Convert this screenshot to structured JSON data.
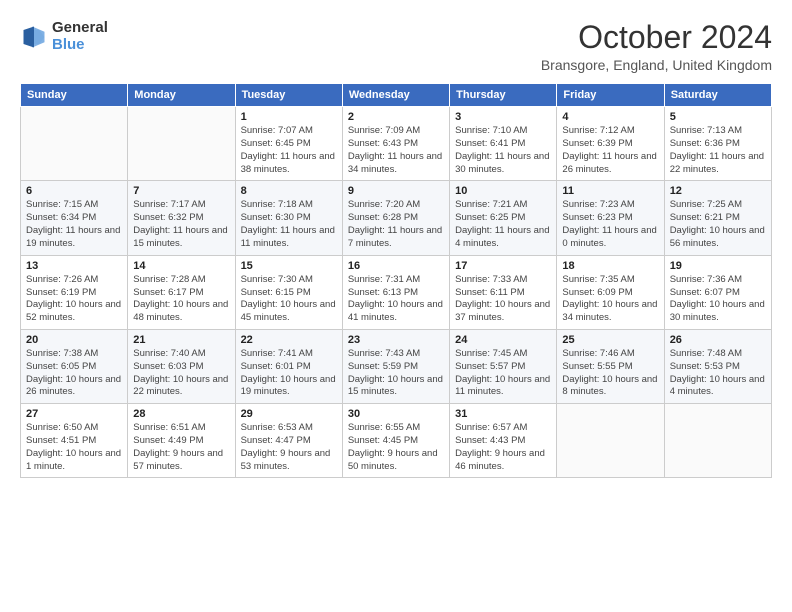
{
  "logo": {
    "line1": "General",
    "line2": "Blue",
    "icon_color": "#4a90d9"
  },
  "header": {
    "month_year": "October 2024",
    "location": "Bransgore, England, United Kingdom"
  },
  "days_of_week": [
    "Sunday",
    "Monday",
    "Tuesday",
    "Wednesday",
    "Thursday",
    "Friday",
    "Saturday"
  ],
  "weeks": [
    [
      {
        "day": "",
        "sunrise": "",
        "sunset": "",
        "daylight": "",
        "empty": true
      },
      {
        "day": "",
        "sunrise": "",
        "sunset": "",
        "daylight": "",
        "empty": true
      },
      {
        "day": "1",
        "sunrise": "Sunrise: 7:07 AM",
        "sunset": "Sunset: 6:45 PM",
        "daylight": "Daylight: 11 hours and 38 minutes.",
        "empty": false
      },
      {
        "day": "2",
        "sunrise": "Sunrise: 7:09 AM",
        "sunset": "Sunset: 6:43 PM",
        "daylight": "Daylight: 11 hours and 34 minutes.",
        "empty": false
      },
      {
        "day": "3",
        "sunrise": "Sunrise: 7:10 AM",
        "sunset": "Sunset: 6:41 PM",
        "daylight": "Daylight: 11 hours and 30 minutes.",
        "empty": false
      },
      {
        "day": "4",
        "sunrise": "Sunrise: 7:12 AM",
        "sunset": "Sunset: 6:39 PM",
        "daylight": "Daylight: 11 hours and 26 minutes.",
        "empty": false
      },
      {
        "day": "5",
        "sunrise": "Sunrise: 7:13 AM",
        "sunset": "Sunset: 6:36 PM",
        "daylight": "Daylight: 11 hours and 22 minutes.",
        "empty": false
      }
    ],
    [
      {
        "day": "6",
        "sunrise": "Sunrise: 7:15 AM",
        "sunset": "Sunset: 6:34 PM",
        "daylight": "Daylight: 11 hours and 19 minutes.",
        "empty": false
      },
      {
        "day": "7",
        "sunrise": "Sunrise: 7:17 AM",
        "sunset": "Sunset: 6:32 PM",
        "daylight": "Daylight: 11 hours and 15 minutes.",
        "empty": false
      },
      {
        "day": "8",
        "sunrise": "Sunrise: 7:18 AM",
        "sunset": "Sunset: 6:30 PM",
        "daylight": "Daylight: 11 hours and 11 minutes.",
        "empty": false
      },
      {
        "day": "9",
        "sunrise": "Sunrise: 7:20 AM",
        "sunset": "Sunset: 6:28 PM",
        "daylight": "Daylight: 11 hours and 7 minutes.",
        "empty": false
      },
      {
        "day": "10",
        "sunrise": "Sunrise: 7:21 AM",
        "sunset": "Sunset: 6:25 PM",
        "daylight": "Daylight: 11 hours and 4 minutes.",
        "empty": false
      },
      {
        "day": "11",
        "sunrise": "Sunrise: 7:23 AM",
        "sunset": "Sunset: 6:23 PM",
        "daylight": "Daylight: 11 hours and 0 minutes.",
        "empty": false
      },
      {
        "day": "12",
        "sunrise": "Sunrise: 7:25 AM",
        "sunset": "Sunset: 6:21 PM",
        "daylight": "Daylight: 10 hours and 56 minutes.",
        "empty": false
      }
    ],
    [
      {
        "day": "13",
        "sunrise": "Sunrise: 7:26 AM",
        "sunset": "Sunset: 6:19 PM",
        "daylight": "Daylight: 10 hours and 52 minutes.",
        "empty": false
      },
      {
        "day": "14",
        "sunrise": "Sunrise: 7:28 AM",
        "sunset": "Sunset: 6:17 PM",
        "daylight": "Daylight: 10 hours and 48 minutes.",
        "empty": false
      },
      {
        "day": "15",
        "sunrise": "Sunrise: 7:30 AM",
        "sunset": "Sunset: 6:15 PM",
        "daylight": "Daylight: 10 hours and 45 minutes.",
        "empty": false
      },
      {
        "day": "16",
        "sunrise": "Sunrise: 7:31 AM",
        "sunset": "Sunset: 6:13 PM",
        "daylight": "Daylight: 10 hours and 41 minutes.",
        "empty": false
      },
      {
        "day": "17",
        "sunrise": "Sunrise: 7:33 AM",
        "sunset": "Sunset: 6:11 PM",
        "daylight": "Daylight: 10 hours and 37 minutes.",
        "empty": false
      },
      {
        "day": "18",
        "sunrise": "Sunrise: 7:35 AM",
        "sunset": "Sunset: 6:09 PM",
        "daylight": "Daylight: 10 hours and 34 minutes.",
        "empty": false
      },
      {
        "day": "19",
        "sunrise": "Sunrise: 7:36 AM",
        "sunset": "Sunset: 6:07 PM",
        "daylight": "Daylight: 10 hours and 30 minutes.",
        "empty": false
      }
    ],
    [
      {
        "day": "20",
        "sunrise": "Sunrise: 7:38 AM",
        "sunset": "Sunset: 6:05 PM",
        "daylight": "Daylight: 10 hours and 26 minutes.",
        "empty": false
      },
      {
        "day": "21",
        "sunrise": "Sunrise: 7:40 AM",
        "sunset": "Sunset: 6:03 PM",
        "daylight": "Daylight: 10 hours and 22 minutes.",
        "empty": false
      },
      {
        "day": "22",
        "sunrise": "Sunrise: 7:41 AM",
        "sunset": "Sunset: 6:01 PM",
        "daylight": "Daylight: 10 hours and 19 minutes.",
        "empty": false
      },
      {
        "day": "23",
        "sunrise": "Sunrise: 7:43 AM",
        "sunset": "Sunset: 5:59 PM",
        "daylight": "Daylight: 10 hours and 15 minutes.",
        "empty": false
      },
      {
        "day": "24",
        "sunrise": "Sunrise: 7:45 AM",
        "sunset": "Sunset: 5:57 PM",
        "daylight": "Daylight: 10 hours and 11 minutes.",
        "empty": false
      },
      {
        "day": "25",
        "sunrise": "Sunrise: 7:46 AM",
        "sunset": "Sunset: 5:55 PM",
        "daylight": "Daylight: 10 hours and 8 minutes.",
        "empty": false
      },
      {
        "day": "26",
        "sunrise": "Sunrise: 7:48 AM",
        "sunset": "Sunset: 5:53 PM",
        "daylight": "Daylight: 10 hours and 4 minutes.",
        "empty": false
      }
    ],
    [
      {
        "day": "27",
        "sunrise": "Sunrise: 6:50 AM",
        "sunset": "Sunset: 4:51 PM",
        "daylight": "Daylight: 10 hours and 1 minute.",
        "empty": false
      },
      {
        "day": "28",
        "sunrise": "Sunrise: 6:51 AM",
        "sunset": "Sunset: 4:49 PM",
        "daylight": "Daylight: 9 hours and 57 minutes.",
        "empty": false
      },
      {
        "day": "29",
        "sunrise": "Sunrise: 6:53 AM",
        "sunset": "Sunset: 4:47 PM",
        "daylight": "Daylight: 9 hours and 53 minutes.",
        "empty": false
      },
      {
        "day": "30",
        "sunrise": "Sunrise: 6:55 AM",
        "sunset": "Sunset: 4:45 PM",
        "daylight": "Daylight: 9 hours and 50 minutes.",
        "empty": false
      },
      {
        "day": "31",
        "sunrise": "Sunrise: 6:57 AM",
        "sunset": "Sunset: 4:43 PM",
        "daylight": "Daylight: 9 hours and 46 minutes.",
        "empty": false
      },
      {
        "day": "",
        "sunrise": "",
        "sunset": "",
        "daylight": "",
        "empty": true
      },
      {
        "day": "",
        "sunrise": "",
        "sunset": "",
        "daylight": "",
        "empty": true
      }
    ]
  ]
}
